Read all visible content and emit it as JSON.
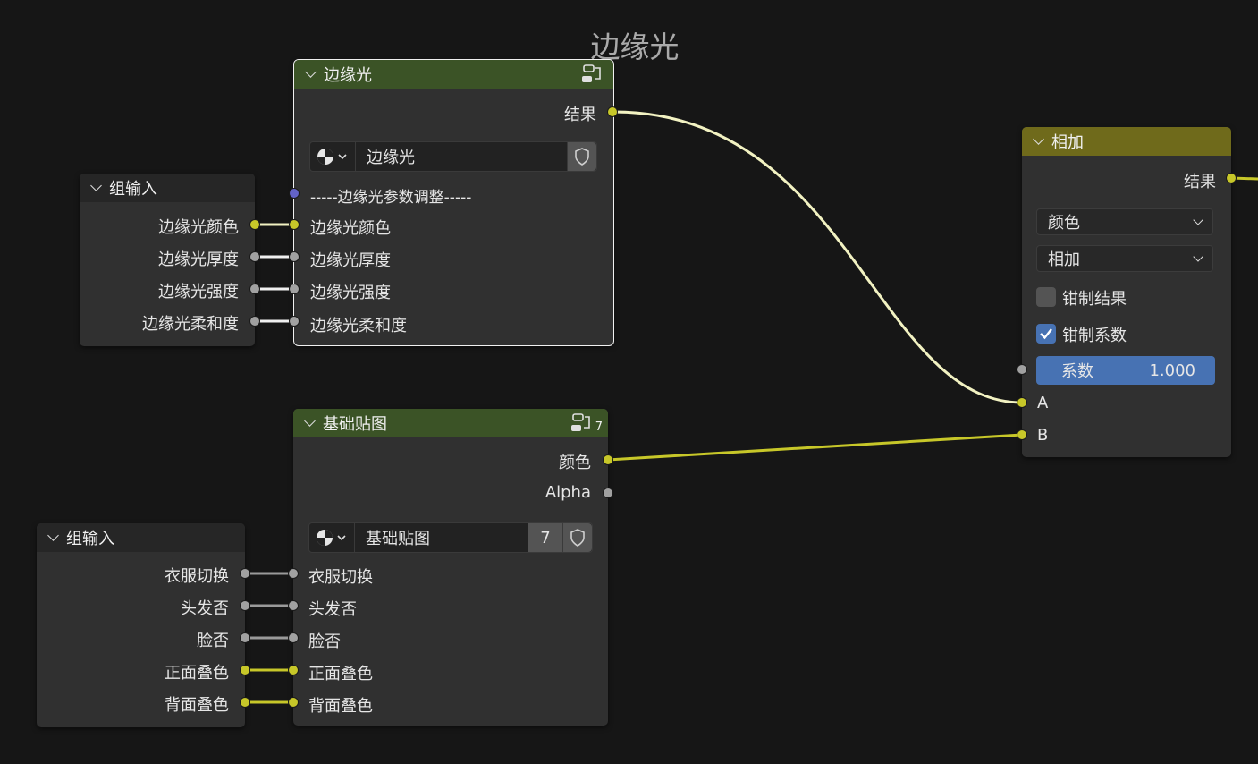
{
  "frame": {
    "title": "边缘光"
  },
  "rim_group_node": {
    "title": "边缘光",
    "output_label": "结果",
    "datablock_name": "边缘光",
    "separator_label": "-----边缘光参数调整-----",
    "inputs": [
      "边缘光颜色",
      "边缘光厚度",
      "边缘光强度",
      "边缘光柔和度"
    ]
  },
  "group_input_1": {
    "title": "组输入",
    "outputs": [
      "边缘光颜色",
      "边缘光厚度",
      "边缘光强度",
      "边缘光柔和度"
    ]
  },
  "base_group_node": {
    "title": "基础贴图",
    "header_user_count": "7",
    "outputs": [
      "颜色",
      "Alpha"
    ],
    "datablock_name": "基础贴图",
    "user_count": "7",
    "inputs": [
      "衣服切换",
      "头发否",
      "脸否",
      "正面叠色",
      "背面叠色"
    ]
  },
  "group_input_2": {
    "title": "组输入",
    "outputs": [
      "衣服切换",
      "头发否",
      "脸否",
      "正面叠色",
      "背面叠色"
    ]
  },
  "mix_node": {
    "title": "相加",
    "output_label": "结果",
    "data_type": "颜色",
    "blend_mode": "相加",
    "clamp_result_label": "钳制结果",
    "clamp_result": false,
    "clamp_factor_label": "钳制系数",
    "clamp_factor": true,
    "factor_label": "系数",
    "factor_value": "1.000",
    "input_a": "A",
    "input_b": "B"
  },
  "colors": {
    "background": "#161616",
    "group_header": "#3b5326",
    "mix_header": "#6f6a1b",
    "socket_color": "#c7c729",
    "socket_float": "#a1a1a1",
    "socket_shader": "#6363c7",
    "accent": "#4772b3"
  }
}
